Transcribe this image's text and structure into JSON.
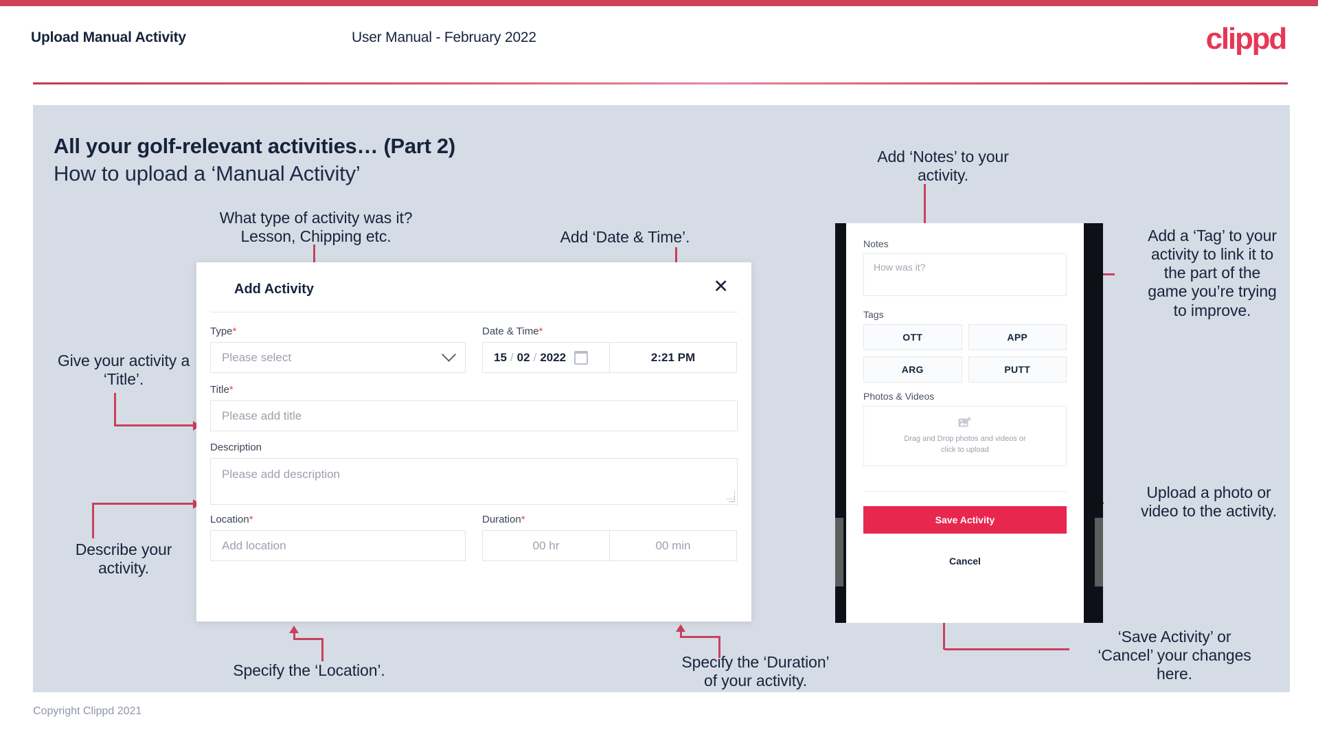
{
  "top_bar_color": "#cf4257",
  "brand": {
    "name": "clippd",
    "color": "#e63757"
  },
  "header": {
    "left_title": "Upload Manual Activity",
    "center_title": "User Manual - February 2022"
  },
  "slide": {
    "title_line1": "All your golf-relevant activities… (Part 2)",
    "title_line2": "How to upload a ‘Manual Activity’",
    "background": "#d6dce5"
  },
  "footer": {
    "copyright": "Copyright Clippd 2021"
  },
  "annotations": {
    "type_field": "What type of activity was it?\nLesson, Chipping etc.",
    "date_time": "Add ‘Date & Time’.",
    "title_field": "Give your activity a\n‘Title’.",
    "description_field": "Describe your\nactivity.",
    "location_field": "Specify the ‘Location’.",
    "duration_field": "Specify the ‘Duration’\nof your activity.",
    "notes_field": "Add ‘Notes’ to your\nactivity.",
    "tags_field": "Add a ‘Tag’ to your\nactivity to link it to\nthe part of the\ngame you’re trying\nto improve.",
    "photos_field": "Upload a photo or\nvideo to the activity.",
    "save_cancel": "‘Save Activity’ or\n‘Cancel’ your changes\nhere."
  },
  "modal": {
    "title": "Add Activity",
    "close_icon": "✕",
    "fields": {
      "type": {
        "label": "Type",
        "required": "*",
        "placeholder": "Please select",
        "icon": "chevron-down-icon"
      },
      "datetime": {
        "label": "Date & Time",
        "required": "*",
        "day": "15",
        "sep1": "/",
        "month": "02",
        "sep2": "/",
        "year": "2022",
        "icon": "calendar-icon",
        "time": "2:21 PM"
      },
      "title": {
        "label": "Title",
        "required": "*",
        "placeholder": "Please add title"
      },
      "description": {
        "label": "Description",
        "required": "",
        "placeholder": "Please add description"
      },
      "location": {
        "label": "Location",
        "required": "*",
        "placeholder": "Add location"
      },
      "duration": {
        "label": "Duration",
        "required": "*",
        "hours": "00 hr",
        "minutes": "00 min"
      }
    }
  },
  "phone": {
    "notes": {
      "label": "Notes",
      "placeholder": "How was it?"
    },
    "tags": {
      "label": "Tags",
      "options": [
        "OTT",
        "APP",
        "ARG",
        "PUTT"
      ]
    },
    "photos": {
      "label": "Photos & Videos",
      "icon": "add-image-icon",
      "dropzone_line1": "Drag and Drop photos and videos or",
      "dropzone_line2": "click to upload"
    },
    "save_label": "Save Activity",
    "save_color": "#e8274f",
    "cancel_label": "Cancel"
  }
}
